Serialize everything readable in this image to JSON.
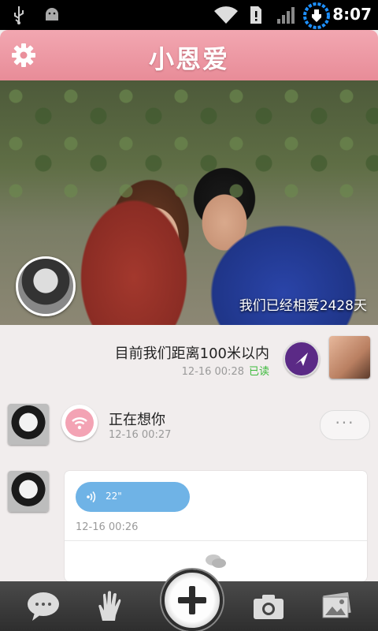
{
  "status_bar": {
    "time": "8:07"
  },
  "header": {
    "title": "小恩爱"
  },
  "cover": {
    "caption": "我们已经相爱2428天"
  },
  "messages": {
    "distance": {
      "text": "目前我们距离100米以内",
      "time": "12-16 00:28",
      "read": "已读"
    },
    "missing": {
      "text": "正在想你",
      "time": "12-16 00:27",
      "more": "···"
    },
    "voice": {
      "duration": "22\"",
      "time": "12-16 00:26"
    }
  },
  "colors": {
    "header": "#e88c98",
    "accent_read": "#3cba3c",
    "voice": "#6fb3e6",
    "nav": "#5b2a86"
  },
  "icons": {
    "settings": "gear-icon",
    "navigate": "navigation-arrow-icon",
    "wifi": "wifi-icon",
    "chat": "chat-bubble-icon",
    "hand": "hand-icon",
    "plus": "plus-icon",
    "camera": "camera-icon",
    "album": "photo-album-icon"
  }
}
